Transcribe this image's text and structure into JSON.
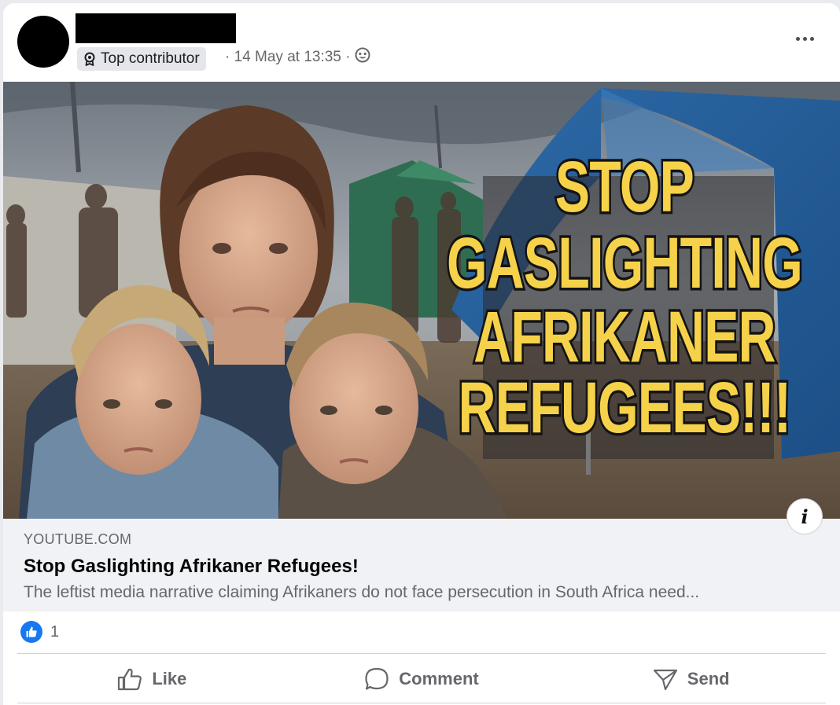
{
  "post": {
    "badge": "Top contributor",
    "meta": "· 14 May at 13:35 ·"
  },
  "hero": {
    "headline_lines": [
      "STOP",
      "GASLIGHTING",
      "AFRIKANER",
      "REFUGEES!!!"
    ]
  },
  "link": {
    "domain": "YOUTUBE.COM",
    "title": "Stop Gaslighting Afrikaner Refugees!",
    "description": "The leftist media narrative claiming Afrikaners do not face persecution in South Africa need..."
  },
  "reactions": {
    "count": "1"
  },
  "actions": {
    "like": "Like",
    "comment": "Comment",
    "send": "Send"
  },
  "icons": {
    "badge": "top-contributor-badge-icon",
    "audience": "public-globe-icon",
    "more": "more-options-icon",
    "info": "info-icon",
    "like_reaction": "thumbs-up-reaction-icon"
  },
  "colors": {
    "headline_yellow": "#f6d24a",
    "like_blue": "#1877f2",
    "secondary_text": "#65676b"
  }
}
